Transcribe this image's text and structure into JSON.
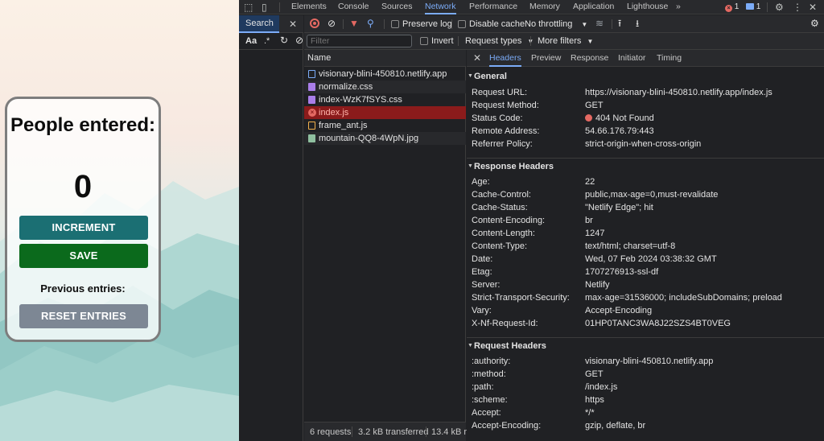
{
  "app": {
    "title": "People entered:",
    "count": "0",
    "increment_label": "INCREMENT",
    "save_label": "SAVE",
    "previous_label": "Previous entries:",
    "reset_label": "RESET ENTRIES"
  },
  "devtools": {
    "tabs": [
      "Elements",
      "Console",
      "Sources",
      "Network",
      "Performance",
      "Memory",
      "Application",
      "Lighthouse"
    ],
    "active_tab": "Network",
    "more_tabs": "»",
    "error_count": "1",
    "message_count": "1",
    "search_tab": "Search",
    "search_case": "Aa",
    "search_regex": ".*",
    "toolbar": {
      "preserve_log": "Preserve log",
      "disable_cache": "Disable cache",
      "throttling": "No throttling"
    },
    "filter": {
      "placeholder": "Filter",
      "invert": "Invert",
      "request_types": "Request types",
      "more_filters": "More filters"
    },
    "request_list": {
      "header": "Name",
      "items": [
        {
          "name": "visionary-blini-450810.netlify.app",
          "type": "document"
        },
        {
          "name": "normalize.css",
          "type": "css"
        },
        {
          "name": "index-WzK7fSYS.css",
          "type": "css"
        },
        {
          "name": "index.js",
          "type": "error"
        },
        {
          "name": "frame_ant.js",
          "type": "script"
        },
        {
          "name": "mountain-QQ8-4WpN.jpg",
          "type": "image"
        }
      ]
    },
    "status": {
      "requests": "6 requests",
      "transferred": "3.2 kB transferred",
      "resources": "13.4 kB r"
    },
    "detail_tabs": [
      "Headers",
      "Preview",
      "Response",
      "Initiator",
      "Timing"
    ],
    "active_detail_tab": "Headers",
    "general": {
      "title": "General",
      "rows": [
        {
          "k": "Request URL:",
          "v": "https://visionary-blini-450810.netlify.app/index.js"
        },
        {
          "k": "Request Method:",
          "v": "GET"
        },
        {
          "k": "Status Code:",
          "v": "404 Not Found"
        },
        {
          "k": "Remote Address:",
          "v": "54.66.176.79:443"
        },
        {
          "k": "Referrer Policy:",
          "v": "strict-origin-when-cross-origin"
        }
      ]
    },
    "response_headers": {
      "title": "Response Headers",
      "rows": [
        {
          "k": "Age:",
          "v": "22"
        },
        {
          "k": "Cache-Control:",
          "v": "public,max-age=0,must-revalidate"
        },
        {
          "k": "Cache-Status:",
          "v": "\"Netlify Edge\"; hit"
        },
        {
          "k": "Content-Encoding:",
          "v": "br"
        },
        {
          "k": "Content-Length:",
          "v": "1247"
        },
        {
          "k": "Content-Type:",
          "v": "text/html; charset=utf-8"
        },
        {
          "k": "Date:",
          "v": "Wed, 07 Feb 2024 03:38:32 GMT"
        },
        {
          "k": "Etag:",
          "v": "1707276913-ssl-df"
        },
        {
          "k": "Server:",
          "v": "Netlify"
        },
        {
          "k": "Strict-Transport-Security:",
          "v": "max-age=31536000; includeSubDomains; preload"
        },
        {
          "k": "Vary:",
          "v": "Accept-Encoding"
        },
        {
          "k": "X-Nf-Request-Id:",
          "v": "01HP0TANC3WA8J22SZS4BT0VEG"
        }
      ]
    },
    "request_headers": {
      "title": "Request Headers",
      "rows": [
        {
          "k": ":authority:",
          "v": "visionary-blini-450810.netlify.app"
        },
        {
          "k": ":method:",
          "v": "GET"
        },
        {
          "k": ":path:",
          "v": "/index.js"
        },
        {
          "k": ":scheme:",
          "v": "https"
        },
        {
          "k": "Accept:",
          "v": "*/*"
        },
        {
          "k": "Accept-Encoding:",
          "v": "gzip, deflate, br"
        }
      ]
    },
    "colors": {
      "accent": "#7cacf8",
      "error_row": "#8b1b1b",
      "error": "#e46962",
      "record": "#e46962"
    }
  }
}
